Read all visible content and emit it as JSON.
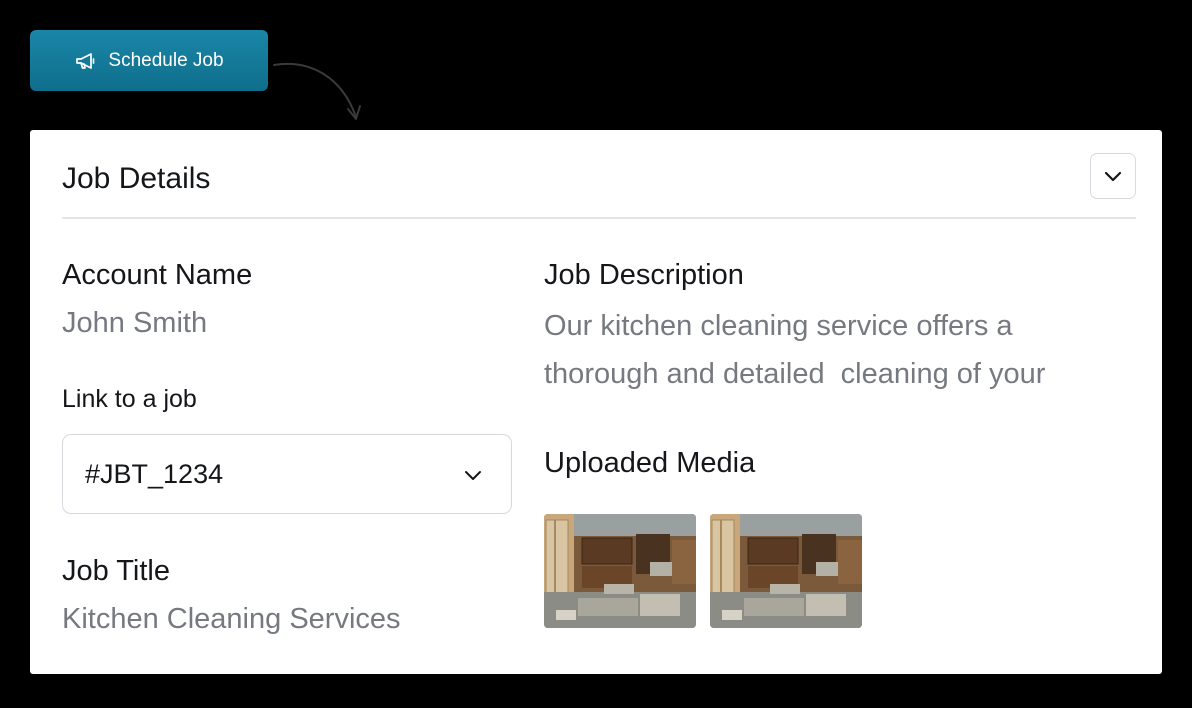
{
  "schedule_button": {
    "label": "Schedule Job",
    "icon": "megaphone-icon"
  },
  "card": {
    "title": "Job Details",
    "collapse_icon": "chevron-down-icon",
    "account": {
      "label": "Account Name",
      "value": "John Smith"
    },
    "link_job": {
      "label": "Link to a job",
      "selected": "#JBT_1234"
    },
    "job_title": {
      "label": "Job Title",
      "value": "Kitchen Cleaning Services"
    },
    "job_description": {
      "label": "Job Description",
      "line1": "Our kitchen cleaning service offers a",
      "line2": "thorough and detailed  cleaning of your"
    },
    "media": {
      "label": "Uploaded Media",
      "thumbnails": [
        "kitchen-photo",
        "kitchen-photo"
      ]
    }
  },
  "colors": {
    "background": "#000000",
    "accent": "#137a9b",
    "card": "#ffffff",
    "text_primary": "#14161a",
    "text_secondary": "#767a80"
  }
}
